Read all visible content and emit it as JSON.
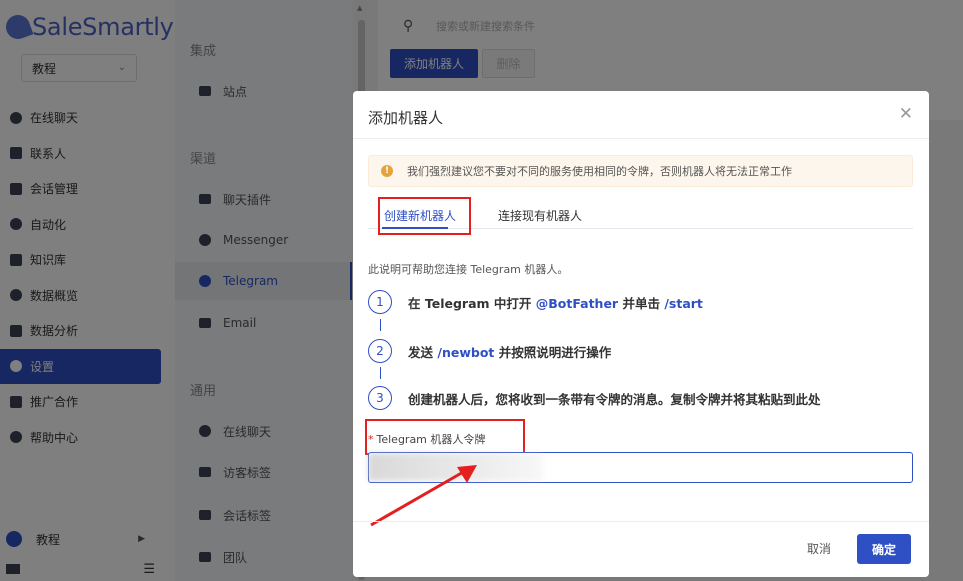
{
  "sidebar": {
    "logo_text": "SaleSmartly",
    "workspace": "教程",
    "items": [
      {
        "label": "在线聊天",
        "icon": "chat-bubble-icon"
      },
      {
        "label": "联系人",
        "icon": "contacts-icon"
      },
      {
        "label": "会话管理",
        "icon": "layers-icon"
      },
      {
        "label": "自动化",
        "icon": "automation-icon"
      },
      {
        "label": "知识库",
        "icon": "book-icon"
      },
      {
        "label": "数据概览",
        "icon": "dashboard-icon"
      },
      {
        "label": "数据分析",
        "icon": "bar-chart-icon"
      },
      {
        "label": "设置",
        "icon": "settings-icon",
        "active": true
      },
      {
        "label": "推广合作",
        "icon": "gift-icon"
      },
      {
        "label": "帮助中心",
        "icon": "help-icon"
      }
    ],
    "bottom_user": "教程"
  },
  "settings_panel": {
    "section_integration": "集成",
    "item_site": "站点",
    "section_channels": "渠道",
    "item_chat_plugin": "聊天插件",
    "item_messenger": "Messenger",
    "item_telegram": "Telegram",
    "item_email": "Email",
    "section_general": "通用",
    "item_live_chat": "在线聊天",
    "item_visitor_tags": "访客标签",
    "item_session_tags": "会话标签",
    "item_team": "团队"
  },
  "main": {
    "search_placeholder": "搜索或新建搜索条件",
    "add_bot_button": "添加机器人",
    "delete_button": "删除"
  },
  "modal": {
    "title": "添加机器人",
    "alert": "我们强烈建议您不要对不同的服务使用相同的令牌，否则机器人将无法正常工作",
    "tab_create": "创建新机器人",
    "tab_connect": "连接现有机器人",
    "intro": "此说明可帮助您连接 Telegram 机器人。",
    "step1_a": "在 Telegram 中打开",
    "step1_link": "@BotFather",
    "step1_b": "并单击",
    "step1_cmd": "/start",
    "step2_a": "发送",
    "step2_cmd": "/newbot",
    "step2_b": "并按照说明进行操作",
    "step3": "创建机器人后，您将收到一条带有令牌的消息。复制令牌并将其粘贴到此处",
    "token_label": "Telegram 机器人令牌",
    "required_mark": "*",
    "cancel_button": "取消",
    "ok_button": "确定"
  },
  "colors": {
    "primary": "#2f4fc4",
    "highlight_red": "#e31f1f",
    "warning": "#e6a23c"
  }
}
